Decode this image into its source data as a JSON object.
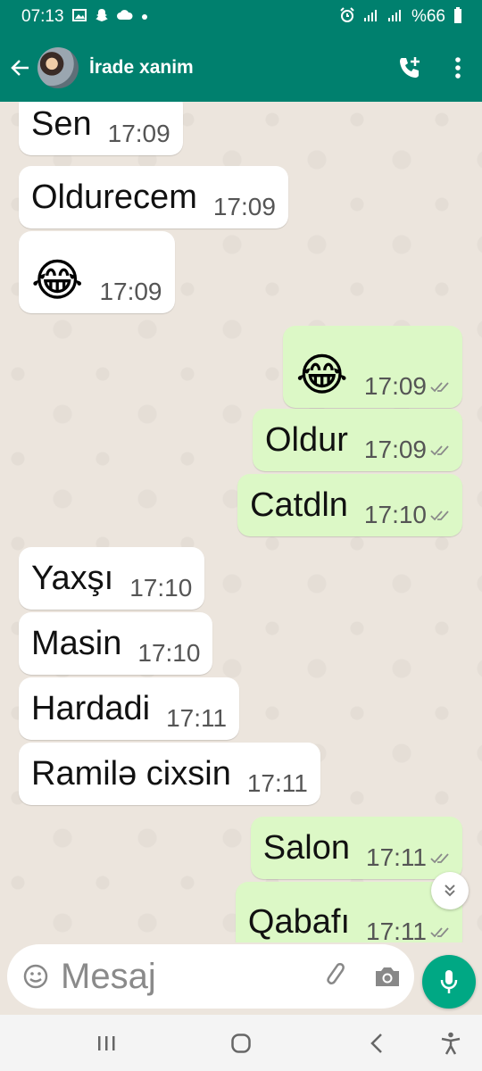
{
  "status_bar": {
    "time": "07:13",
    "battery": "%66"
  },
  "header": {
    "contact_name": "İrade xanim"
  },
  "messages": [
    {
      "dir": "in",
      "text": "Sen",
      "time": "17:09"
    },
    {
      "dir": "in",
      "text": "Oldurecem",
      "time": "17:09"
    },
    {
      "dir": "in",
      "emoji": "😂",
      "time": "17:09"
    },
    {
      "dir": "out",
      "emoji": "😂",
      "time": "17:09"
    },
    {
      "dir": "out",
      "text": "Oldur",
      "time": "17:09"
    },
    {
      "dir": "out",
      "text": "Catdln",
      "time": "17:10"
    },
    {
      "dir": "in",
      "text": "Yaxşı",
      "time": "17:10"
    },
    {
      "dir": "in",
      "text": "Masin",
      "time": "17:10"
    },
    {
      "dir": "in",
      "text": "Hardadi",
      "time": "17:11"
    },
    {
      "dir": "in",
      "text": "Ramilə cixsin",
      "time": "17:11"
    },
    {
      "dir": "out",
      "text": "Salon",
      "time": "17:11"
    },
    {
      "dir": "out",
      "text": "Qabafı",
      "time": "17:11"
    }
  ],
  "composer": {
    "placeholder": "Mesaj"
  },
  "colors": {
    "header": "#00806e",
    "incoming_bubble": "#ffffff",
    "outgoing_bubble": "#dcf8c6",
    "mic_button": "#00a884",
    "chat_background": "#ece5dd"
  }
}
